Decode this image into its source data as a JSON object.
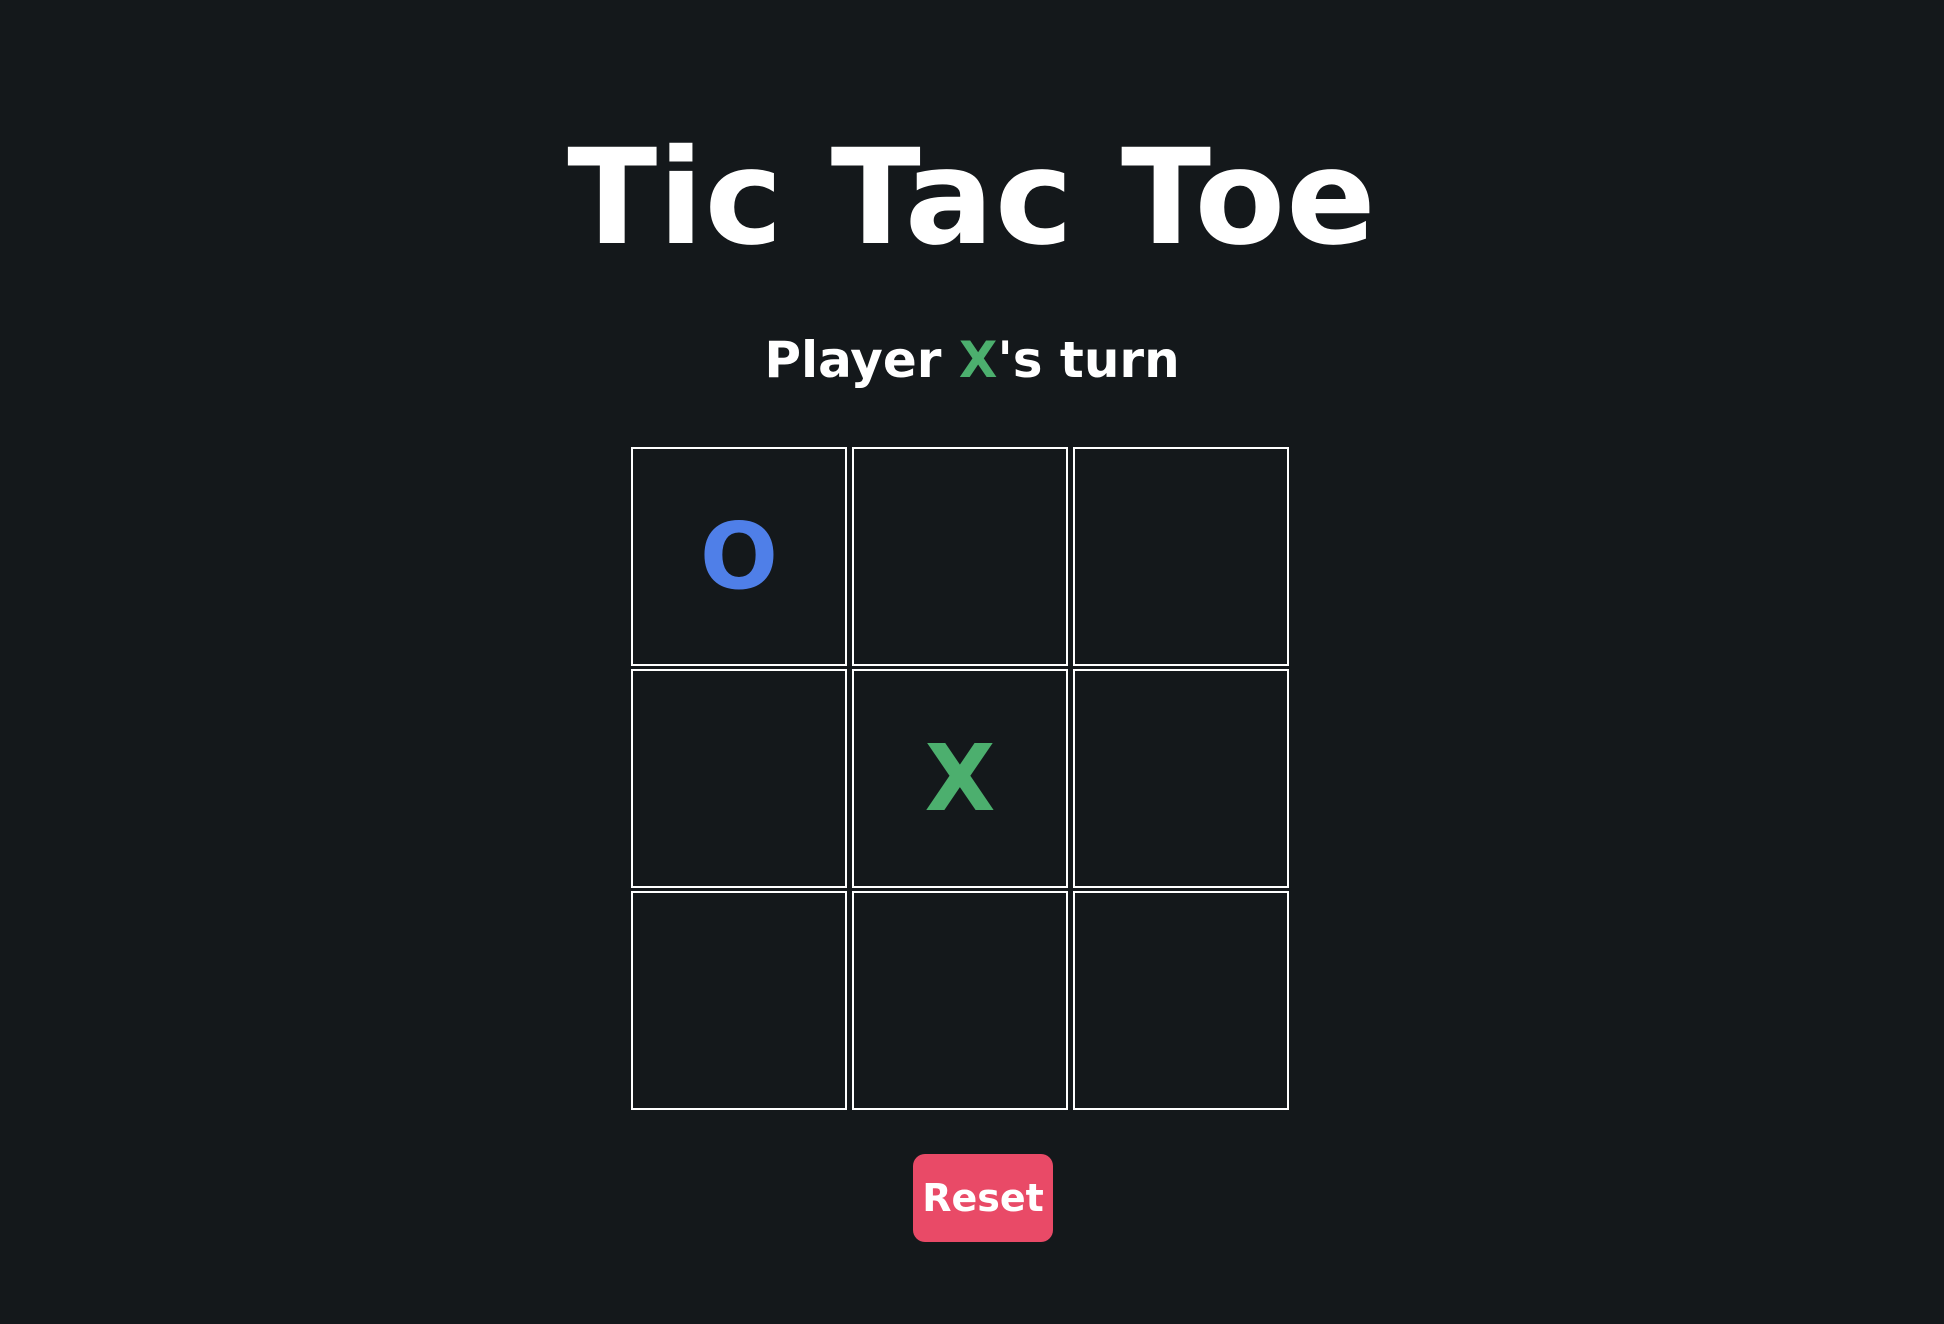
{
  "title": "Tic Tac Toe",
  "status": {
    "prefix": "Player ",
    "player": "X",
    "suffix": "'s turn"
  },
  "board": {
    "cells": [
      "O",
      "",
      "",
      "",
      "X",
      "",
      "",
      "",
      ""
    ]
  },
  "colors": {
    "background": "#14181b",
    "x": "#4caf6e",
    "o": "#4f7fe8",
    "reset": "#e94a67",
    "grid": "#ffffff"
  },
  "reset_button": {
    "label": "Reset"
  }
}
